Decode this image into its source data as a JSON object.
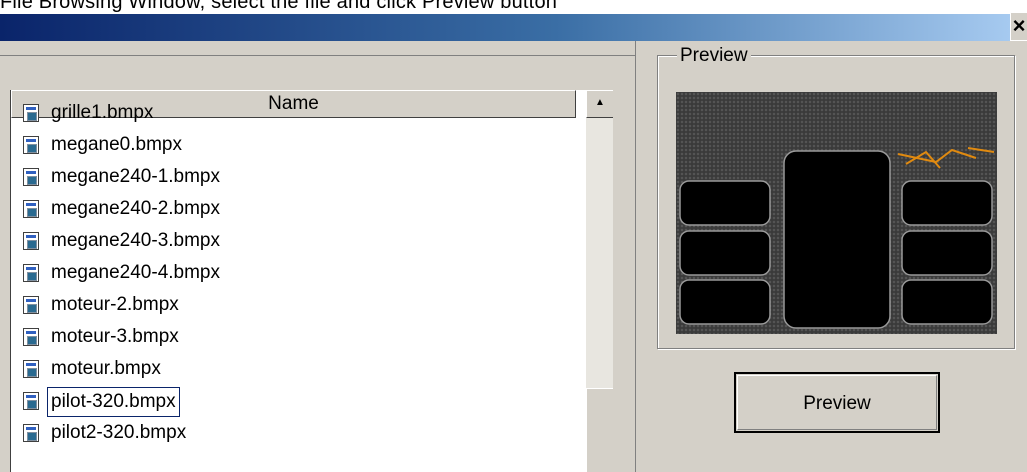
{
  "window": {
    "title": "File Browsing Window, select the file and click Preview button"
  },
  "list": {
    "header_name": "Name",
    "rows": [
      {
        "name": "grille1.bmpx"
      },
      {
        "name": "megane0.bmpx"
      },
      {
        "name": "megane240-1.bmpx"
      },
      {
        "name": "megane240-2.bmpx"
      },
      {
        "name": "megane240-3.bmpx"
      },
      {
        "name": "megane240-4.bmpx"
      },
      {
        "name": "moteur-2.bmpx"
      },
      {
        "name": "moteur-3.bmpx"
      },
      {
        "name": "moteur.bmpx"
      },
      {
        "name": "pilot-320.bmpx"
      },
      {
        "name": "pilot2-320.bmpx"
      }
    ],
    "selected": "pilot-320.bmpx"
  },
  "preview": {
    "group_label": "Preview",
    "button_label": "Preview",
    "image_caption": ""
  },
  "icons": {
    "close": "close-icon",
    "scroll_up": "scroll-up-arrow-icon",
    "file": "bitmap-file-icon"
  },
  "colors": {
    "titlebar_start": "#0a246a",
    "titlebar_end": "#a6caf0",
    "face": "#d4d0c8"
  }
}
